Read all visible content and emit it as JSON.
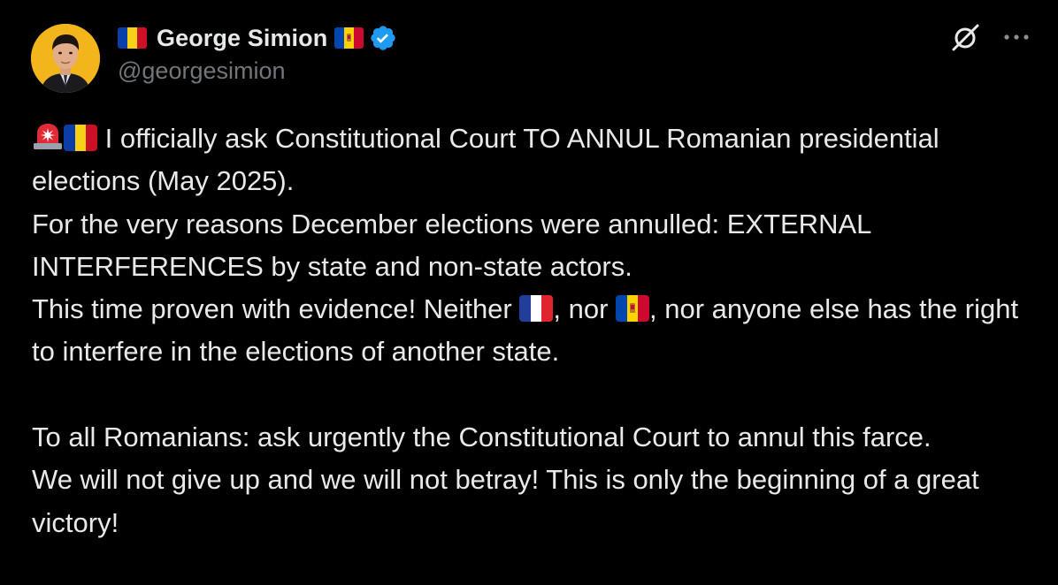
{
  "author": {
    "display_name": "George Simion",
    "handle": "@georgesimion",
    "name_prefix_icon": "romania-flag-icon",
    "name_suffix_icon": "moldova-flag-icon",
    "verified_icon": "verified-badge-icon"
  },
  "actions": {
    "grok_icon": "grok-icon",
    "more_icon": "more-options-icon"
  },
  "tweet": {
    "p1_lead_icons": [
      "siren-emoji",
      "romania-flag-emoji"
    ],
    "p1_line1": " I officially ask Constitutional Court TO ANNUL Romanian presidential elections (May 2025).",
    "p1_line2": "For the very reasons December elections were annulled: EXTERNAL INTERFERENCES by state and non-state actors.",
    "p1_line3a": "This time proven with evidence! Neither ",
    "p1_line3b": ", nor ",
    "p1_line3c": ", nor anyone else has the right to interfere in the elections of another state.",
    "p1_line3_icons": [
      "france-flag-emoji",
      "moldova-flag-emoji"
    ],
    "p2_line1": "To all Romanians: ask urgently the Constitutional Court to annul this farce.",
    "p2_line2": "We will not give up and we will not betray! This is only the beginning of a great victory!"
  },
  "colors": {
    "background": "#000000",
    "text": "#e7e9ea",
    "secondary": "#71767b",
    "verified": "#1d9bf0"
  }
}
